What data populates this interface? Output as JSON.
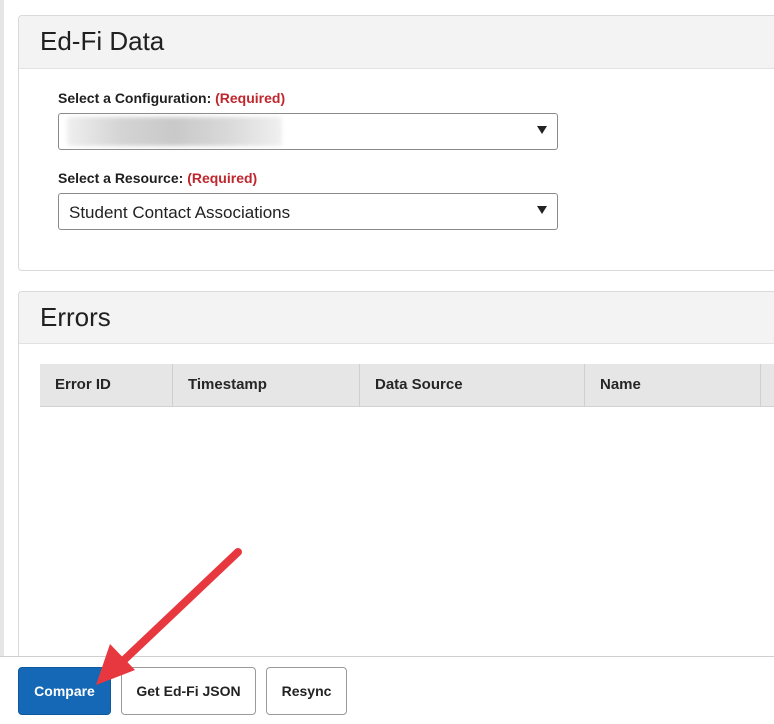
{
  "edfi_card": {
    "title": "Ed-Fi Data",
    "configuration": {
      "label": "Select a Configuration:",
      "required": "(Required)",
      "value": ""
    },
    "resource": {
      "label": "Select a Resource:",
      "required": "(Required)",
      "value": "Student Contact Associations"
    }
  },
  "errors_card": {
    "title": "Errors",
    "columns": [
      "Error ID",
      "Timestamp",
      "Data Source",
      "Name"
    ]
  },
  "footer": {
    "compare_label": "Compare",
    "get_json_label": "Get Ed-Fi JSON",
    "resync_label": "Resync"
  },
  "colors": {
    "primary_button": "#1568b6",
    "required_text": "#c0262d",
    "annotation_arrow": "#e8383f"
  }
}
